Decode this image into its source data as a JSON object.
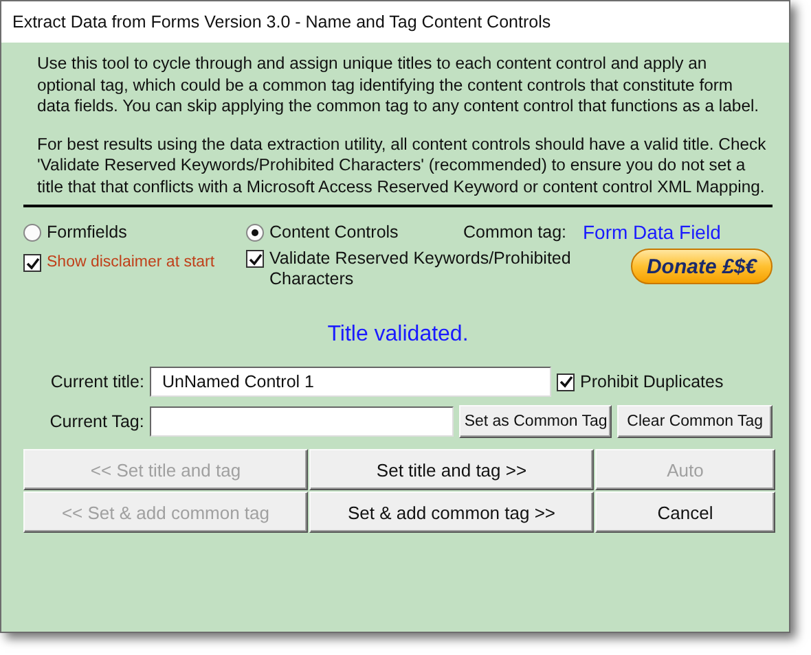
{
  "window": {
    "title": "Extract Data from Forms Version 3.0 - Name and Tag Content Controls"
  },
  "intro": [
    "Use this tool to cycle through and assign unique titles to each content control and apply an optional tag, which could be a common tag identifying the content controls that constitute form data fields. You can skip applying the common tag to any content control that functions as a label.",
    "For best results using the data extraction utility, all content controls should have a valid title. Check 'Validate Reserved Keywords/Prohibited Characters' (recommended) to ensure you do not set a title that that conflicts with a Microsoft Access Reserved Keyword or content control XML Mapping."
  ],
  "mode_options": [
    {
      "label": "Formfields",
      "selected": false
    },
    {
      "label": "Content Controls",
      "selected": true
    }
  ],
  "common_tag": {
    "label": "Common tag:",
    "value": "Form Data Field"
  },
  "options": [
    {
      "label": "Show disclaimer at start",
      "checked": true
    },
    {
      "label": "Validate Reserved Keywords/Prohibited Characters",
      "checked": true
    }
  ],
  "donate_button": {
    "label": "Donate £$€"
  },
  "status": "Title validated.",
  "current_title": {
    "label": "Current title:",
    "value": "UnNamed Control 1"
  },
  "prohibit_duplicates": {
    "label": "Prohibit Duplicates",
    "checked": true
  },
  "current_tag": {
    "label": "Current Tag:"
  },
  "tag_buttons": [
    "Set as Common Tag",
    "Clear Common Tag"
  ],
  "action_buttons": [
    {
      "label": "<< Set title and tag",
      "disabled": true
    },
    {
      "label": "Set title and tag >>",
      "disabled": false
    },
    {
      "label": "Auto",
      "disabled": true
    },
    {
      "label": "<< Set & add common tag",
      "disabled": true
    },
    {
      "label": "Set & add common tag >>",
      "disabled": false
    },
    {
      "label": "Cancel",
      "disabled": false
    }
  ]
}
